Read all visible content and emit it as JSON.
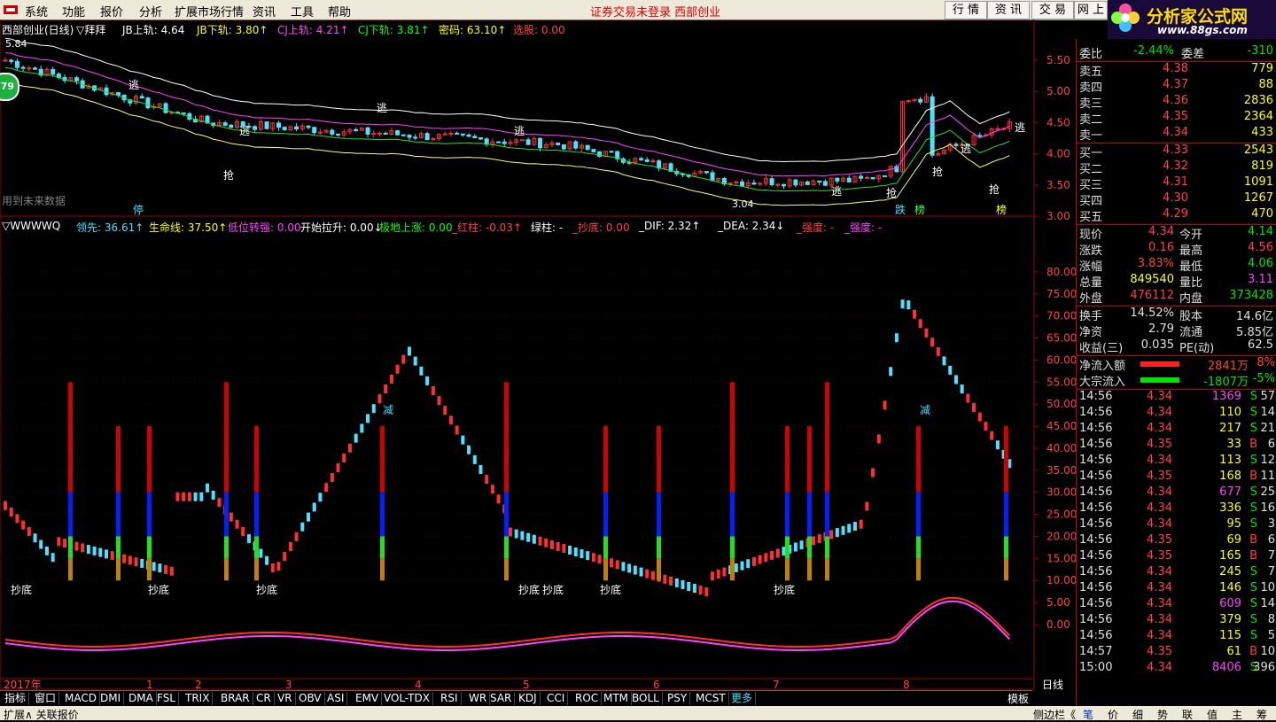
{
  "menu": {
    "items": [
      "系统",
      "功能",
      "报价",
      "分析",
      "扩展市场行情",
      "资讯",
      "工具",
      "帮助"
    ],
    "notice": "证券交易未登录  西部创业",
    "right_buttons": [
      "行 情",
      "资 讯",
      "交 易",
      "网 上"
    ]
  },
  "brand": {
    "name": "分析家公式网",
    "url": "www.88gs.com",
    "code_text": "000557 西部创业"
  },
  "main_chart": {
    "title": "西部创业(日线)",
    "indicator": "▽拜拜",
    "params": [
      {
        "label": "JB上轨: 4.64",
        "color": "#ffffff"
      },
      {
        "label": "JB下轨: 3.80↑",
        "color": "#ffff00"
      },
      {
        "label": "CJ上轨: 4.21↑",
        "color": "#ff40ff"
      },
      {
        "label": "CJ下轨: 3.81↑",
        "color": "#00ff00"
      },
      {
        "label": "密码: 63.10↑",
        "color": "#ffff00"
      },
      {
        "label": "选股: 0.00",
        "color": "#ff4040"
      }
    ],
    "high_label": "5.84",
    "low_label": "3.04",
    "future_note": "用到未来数据",
    "badge": "79",
    "y_axis": [
      "5.50",
      "5.00",
      "4.50",
      "4.00",
      "3.50",
      "3.00"
    ],
    "tags": [
      "逃",
      "抢",
      "财",
      "跌",
      "榜",
      "停"
    ]
  },
  "sub_chart": {
    "title": "▽WWWWQ",
    "params": [
      {
        "label": "领先: 36.61↑",
        "color": "#40e0ff"
      },
      {
        "label": "生命线: 37.50↑",
        "color": "#ffff00"
      },
      {
        "label": "低位转强: 0.00",
        "color": "#ff40ff"
      },
      {
        "label": "开始拉升: 0.00↓",
        "color": "#ffffff"
      },
      {
        "label": "极地上涨: 0.00",
        "color": "#00ff00"
      },
      {
        "label": "_红柱: -0.03↑",
        "color": "#ff4040"
      },
      {
        "label": "绿柱: -",
        "color": "#ffffff"
      },
      {
        "label": "_抄底: 0.00",
        "color": "#ff4040"
      },
      {
        "label": "_DIF: 2.32↑",
        "color": "#ffffff"
      },
      {
        "label": "_DEA: 2.34↓",
        "color": "#ffffff"
      },
      {
        "label": "_强度: -",
        "color": "#ff4040"
      },
      {
        "label": "_强度: -",
        "color": "#ff40ff"
      }
    ],
    "y_axis": [
      "80.00",
      "75.00",
      "70.00",
      "65.00",
      "60.00",
      "55.00",
      "50.00",
      "45.00",
      "40.00",
      "35.00",
      "30.00",
      "25.00",
      "20.00",
      "15.00",
      "10.00",
      "5.00",
      "0.00"
    ],
    "tags": [
      "抄底",
      "减"
    ]
  },
  "x_axis": {
    "labels": [
      "2017年",
      "1",
      "2",
      "3",
      "4",
      "5",
      "6",
      "7",
      "8"
    ],
    "right_label": "日线"
  },
  "indicator_tabs": [
    "指标",
    "窗口",
    "MACD",
    "DMI",
    "DMA",
    "FSL",
    "TRIX",
    "BRAR",
    "CR",
    "VR",
    "OBV",
    "ASI",
    "EMV",
    "VOL-TDX",
    "RSI",
    "WR",
    "SAR",
    "KDJ",
    "CCI",
    "ROC",
    "MTM",
    "BOLL",
    "PSY",
    "MCST",
    "更多"
  ],
  "template_tab": "模板",
  "status": {
    "left": "扩展∧  关联报价",
    "right": "侧边栏《"
  },
  "quote": {
    "webi": {
      "label": "委比",
      "value": "-2.44%",
      "label2": "委差",
      "value2": "-310"
    },
    "sells": [
      {
        "label": "卖五",
        "price": "4.38",
        "vol": "779"
      },
      {
        "label": "卖四",
        "price": "4.37",
        "vol": "88"
      },
      {
        "label": "卖三",
        "price": "4.36",
        "vol": "2836"
      },
      {
        "label": "卖二",
        "price": "4.35",
        "vol": "2364"
      },
      {
        "label": "卖一",
        "price": "4.34",
        "vol": "433"
      }
    ],
    "buys": [
      {
        "label": "买一",
        "price": "4.33",
        "vol": "2543"
      },
      {
        "label": "买二",
        "price": "4.32",
        "vol": "819"
      },
      {
        "label": "买三",
        "price": "4.31",
        "vol": "1091"
      },
      {
        "label": "买四",
        "price": "4.30",
        "vol": "1267"
      },
      {
        "label": "买五",
        "price": "4.29",
        "vol": "470"
      }
    ],
    "stats": [
      {
        "l1": "现价",
        "v1": "4.34",
        "c1": "red",
        "l2": "今开",
        "v2": "4.14",
        "c2": "green"
      },
      {
        "l1": "涨跌",
        "v1": "0.16",
        "c1": "red",
        "l2": "最高",
        "v2": "4.56",
        "c2": "red"
      },
      {
        "l1": "涨幅",
        "v1": "3.83%",
        "c1": "red",
        "l2": "最低",
        "v2": "4.06",
        "c2": "green"
      },
      {
        "l1": "总量",
        "v1": "849540",
        "c1": "yellow",
        "l2": "量比",
        "v2": "3.11",
        "c2": "magenta"
      },
      {
        "l1": "外盘",
        "v1": "476112",
        "c1": "red",
        "l2": "内盘",
        "v2": "373428",
        "c2": "green"
      }
    ],
    "stats2": [
      {
        "l1": "换手",
        "v1": "14.52%",
        "l2": "股本",
        "v2": "14.6亿"
      },
      {
        "l1": "净资",
        "v1": "2.79",
        "l2": "流通",
        "v2": "5.85亿"
      },
      {
        "l1": "收益(三)",
        "v1": "0.035",
        "l2": "PE(动)",
        "v2": "62.5"
      }
    ],
    "flows": [
      {
        "label": "净流入额",
        "value": "2841万",
        "pct": "8%",
        "bar": "#ff2020",
        "color": "red"
      },
      {
        "label": "大宗流入",
        "value": "-1807万",
        "pct": "-5%",
        "bar": "#00e000",
        "color": "green"
      }
    ],
    "ticks": [
      {
        "t": "14:56",
        "p": "4.34",
        "v": "1369",
        "d": "S",
        "n": "57",
        "vc": "magenta"
      },
      {
        "t": "14:56",
        "p": "4.34",
        "v": "110",
        "d": "S",
        "n": "14",
        "vc": "yellow"
      },
      {
        "t": "14:56",
        "p": "4.34",
        "v": "217",
        "d": "S",
        "n": "21",
        "vc": "yellow"
      },
      {
        "t": "14:56",
        "p": "4.35",
        "v": "33",
        "d": "B",
        "n": "6",
        "vc": "yellow"
      },
      {
        "t": "14:56",
        "p": "4.34",
        "v": "113",
        "d": "S",
        "n": "12",
        "vc": "yellow"
      },
      {
        "t": "14:56",
        "p": "4.35",
        "v": "168",
        "d": "B",
        "n": "11",
        "vc": "yellow"
      },
      {
        "t": "14:56",
        "p": "4.34",
        "v": "677",
        "d": "S",
        "n": "25",
        "vc": "magenta"
      },
      {
        "t": "14:56",
        "p": "4.34",
        "v": "336",
        "d": "S",
        "n": "16",
        "vc": "yellow"
      },
      {
        "t": "14:56",
        "p": "4.34",
        "v": "95",
        "d": "S",
        "n": "3",
        "vc": "yellow"
      },
      {
        "t": "14:56",
        "p": "4.35",
        "v": "69",
        "d": "B",
        "n": "6",
        "vc": "yellow"
      },
      {
        "t": "14:56",
        "p": "4.35",
        "v": "165",
        "d": "B",
        "n": "7",
        "vc": "yellow"
      },
      {
        "t": "14:56",
        "p": "4.34",
        "v": "245",
        "d": "S",
        "n": "7",
        "vc": "yellow"
      },
      {
        "t": "14:56",
        "p": "4.34",
        "v": "146",
        "d": "S",
        "n": "10",
        "vc": "yellow"
      },
      {
        "t": "14:56",
        "p": "4.34",
        "v": "609",
        "d": "S",
        "n": "14",
        "vc": "magenta"
      },
      {
        "t": "14:56",
        "p": "4.34",
        "v": "379",
        "d": "S",
        "n": "8",
        "vc": "yellow"
      },
      {
        "t": "14:56",
        "p": "4.34",
        "v": "115",
        "d": "S",
        "n": "5",
        "vc": "yellow"
      },
      {
        "t": "14:57",
        "p": "4.35",
        "v": "61",
        "d": "B",
        "n": "10",
        "vc": "yellow"
      },
      {
        "t": "15:00",
        "p": "4.34",
        "v": "8406",
        "d": "S",
        "n": "396",
        "vc": "magenta"
      }
    ]
  },
  "side_tabs": [
    "笔",
    "价",
    "细",
    "势",
    "联",
    "值",
    "主",
    "筹"
  ]
}
